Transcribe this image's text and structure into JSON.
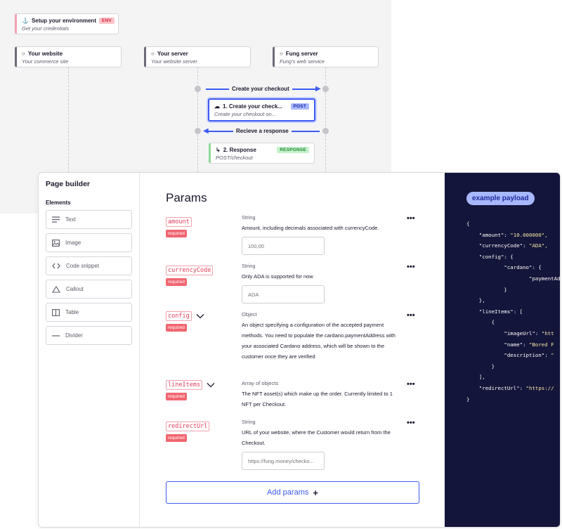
{
  "flow": {
    "setup": {
      "title": "Setup your environment",
      "subtitle": "Get your credentials",
      "badge": "ENV",
      "badge_color": "#f8c4c8"
    },
    "actors": [
      {
        "title": "Your website",
        "subtitle": "Your commerce site"
      },
      {
        "title": "Your server",
        "subtitle": "Your website server"
      },
      {
        "title": "Fung server",
        "subtitle": "Fung's web service"
      }
    ],
    "create_arrow_label": "Create your checkout",
    "post_card": {
      "title": "1. Create your check...",
      "subtitle": "Create your checkout on...",
      "badge": "POST"
    },
    "receive_arrow_label": "Recieve a response",
    "response_card": {
      "title": "2. Response",
      "subtitle": "POST/checkout",
      "badge": "RESPONSE"
    },
    "accent_color": "#3d5af1"
  },
  "builder": {
    "title": "Page builder",
    "elements_heading": "Elements",
    "elements": [
      {
        "label": "Text",
        "icon": "text-lines-icon"
      },
      {
        "label": "Image",
        "icon": "image-icon"
      },
      {
        "label": "Code snippet",
        "icon": "code-icon"
      },
      {
        "label": "Callout",
        "icon": "triangle-icon"
      },
      {
        "label": "Table",
        "icon": "table-icon"
      },
      {
        "label": "Divider",
        "icon": "divider-icon"
      }
    ],
    "params_title": "Params",
    "required_label": "required",
    "params": [
      {
        "name": "amount",
        "type": "String",
        "description": "Amount, including decimals associated with currencyCode.",
        "placeholder": "100,00"
      },
      {
        "name": "currencyCode",
        "type": "String",
        "description": "Only ADA is supported for now",
        "placeholder": "ADA"
      },
      {
        "name": "config",
        "type": "Object",
        "description": "An object specifying a configuration of the accepted payment methods. You need to populate the cardano.paymentAddress with your associated Cardano address, which will be shown to the customer once they are verified"
      },
      {
        "name": "lineItems",
        "type": "Array of objects",
        "description": "The NFT asset(s) which make up the order. Currently limited to 1 NFT per Checkout."
      },
      {
        "name": "redirectUrl",
        "type": "String",
        "description": "URL of your website, where the Customer would return from the Checkout.",
        "placeholder": "https://fung.money/checko..."
      }
    ],
    "add_button_label": "Add params",
    "add_button_icon": "+",
    "payload_badge": "example payload",
    "payload_lines": [
      "{",
      "    \"amount\": \"10.000000\",",
      "    \"currencyCode\": \"ADA\",",
      "    \"config\": {",
      "            \"cardano\": {",
      "                    \"paymentAd",
      "            }",
      "    },",
      "    \"lineItems\": [",
      "        {",
      "            \"imageUrl\": \"htt",
      "            \"name\": \"Bored F",
      "            \"description\": \"",
      "        }",
      "    ],",
      "    \"redirectUrl\": \"https://",
      "}"
    ]
  }
}
